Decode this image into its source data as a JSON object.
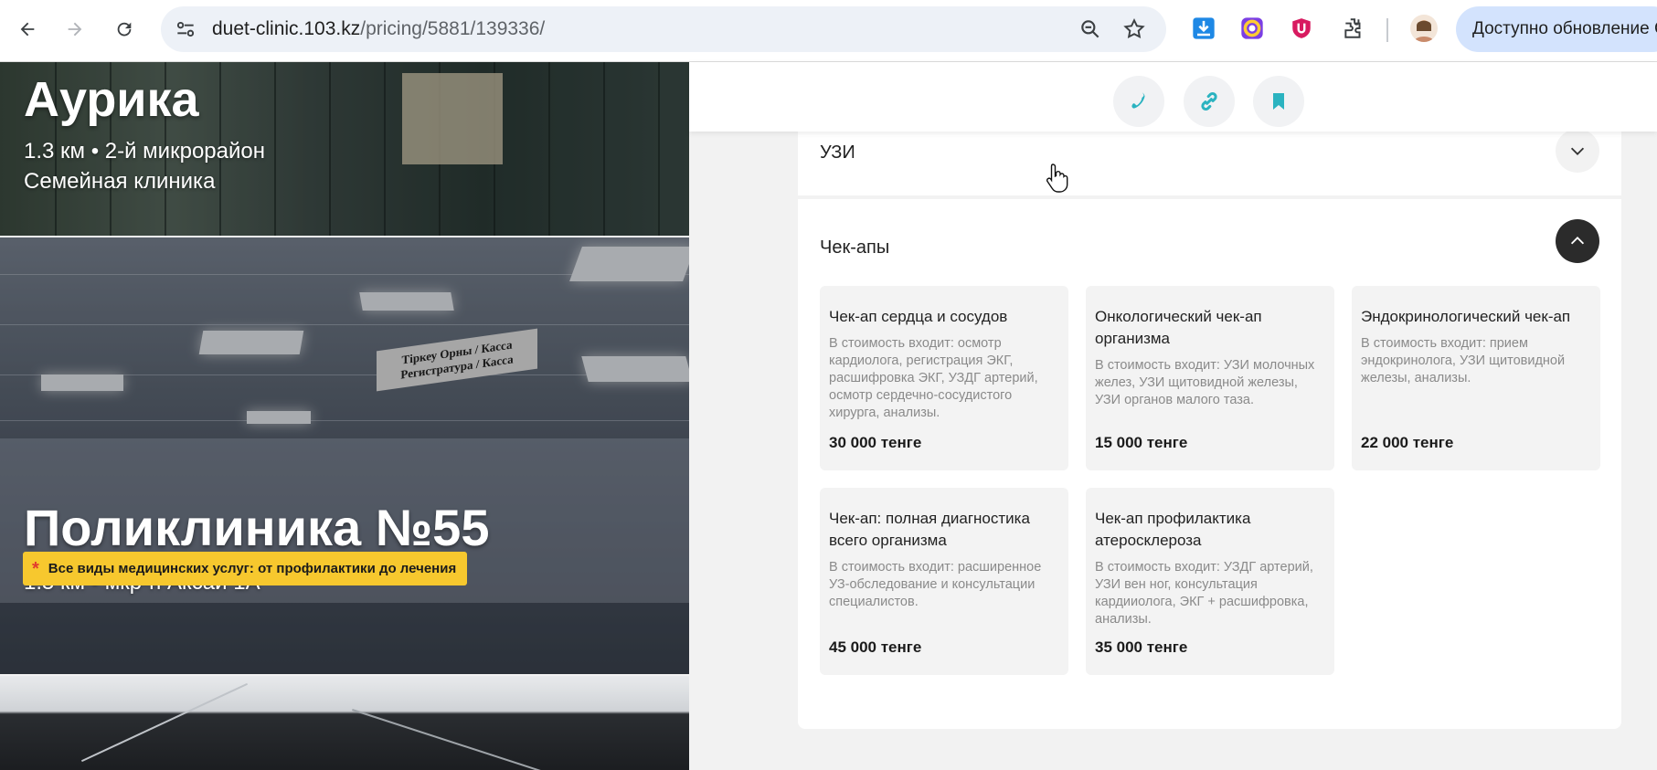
{
  "browser": {
    "url_host": "duet-clinic.103.kz",
    "url_path": "/pricing/5881/139336/",
    "update_label": "Доступно обновление C",
    "icons": [
      "back-icon",
      "forward-icon",
      "reload-icon",
      "site-info-icon",
      "zoom-icon",
      "bookmark-star-icon",
      "download-icon",
      "color-picker-icon",
      "shield-u-icon",
      "extensions-icon",
      "profile-avatar"
    ]
  },
  "clinics": [
    {
      "name": "Аурика",
      "distance": "1.3 км • 2-й микрорайон",
      "type": "Семейная клиника"
    },
    {
      "name": "Поликлиника №55",
      "distance": "1.5 км • мкр-н Аксай 1А",
      "badge": "Все виды медицинских услуг: от профилактики до лечения",
      "badge_star": "*",
      "photo_sign_1": "Тіркеу Орны / Касса",
      "photo_sign_2": "Регистратура / Касса"
    }
  ],
  "actions": {
    "icons": [
      "phone-icon",
      "link-icon",
      "bookmark-icon"
    ]
  },
  "accordion": {
    "uzi_label": "УЗИ",
    "checkups_label": "Чек-апы"
  },
  "checkups": [
    {
      "title": "Чек-ап сердца и сосудов",
      "desc": "В стоимость входит: осмотр кардиолога, регистрация ЭКГ, расшифровка ЭКГ, УЗДГ артерий, осмотр сердечно-сосудистого хирурга, анализы.",
      "price": "30 000 тенге"
    },
    {
      "title": "Онкологический чек-ап организма",
      "desc": "В стоимость входит: УЗИ молочных желез, УЗИ щитовидной железы, УЗИ органов малого таза.",
      "price": "15 000 тенге"
    },
    {
      "title": "Эндокринологический чек-ап",
      "desc": "В стоимость входит: прием эндокринолога, УЗИ щитовидной железы, анализы.",
      "price": "22 000 тенге"
    },
    {
      "title": "Чек-ап: полная диагностика всего организма",
      "desc": "В стоимость входит: расширенное УЗ-обследование и консультации специалистов.",
      "price": "45 000 тенге"
    },
    {
      "title": "Чек-ап профилактика атеросклероза",
      "desc": "В стоимость входит: УЗДГ артерий, УЗИ вен ног, консультация кардииолога, ЭКГ + расшифровка, анализы.",
      "price": "35 000 тенге"
    }
  ],
  "colors": {
    "accent_teal": "#2bb3c0",
    "badge_yellow": "#f7c82e",
    "toggle_dark": "#2b2b2b"
  }
}
